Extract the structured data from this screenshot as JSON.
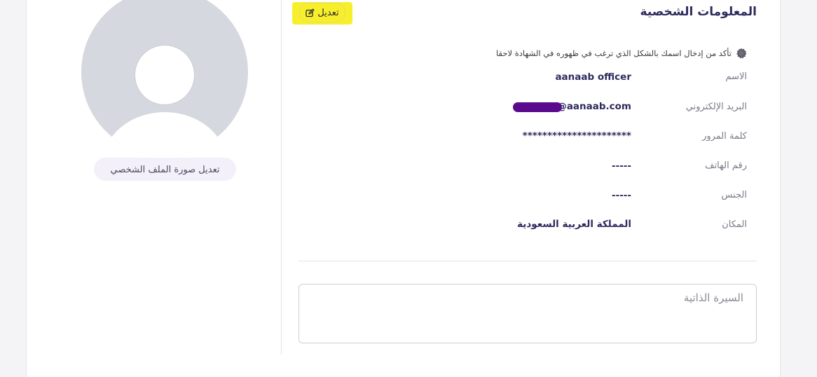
{
  "profile": {
    "section_title": "المعلومات الشخصية",
    "edit_label": "تعديل",
    "edit_photo_label": "تعديل صورة الملف الشخصي",
    "note": "تأكد من إدخال اسمك بالشكل الذي ترغب في ظهوره في الشهادة لاحقا",
    "fields": [
      {
        "label": "الاسم",
        "value": "aanaab officer"
      },
      {
        "label": "البريد الإلكتروني",
        "value": "@aanaab.com"
      },
      {
        "label": "كلمة المرور",
        "value": "**********************"
      },
      {
        "label": "رقم الهاتف",
        "value": "-----"
      },
      {
        "label": "الجنس",
        "value": "-----"
      },
      {
        "label": "المكان",
        "value": "المملكة العربية السعودية"
      }
    ],
    "bio_placeholder": "السيرة الذاتية",
    "bio_value": ""
  },
  "colors": {
    "accent": "#2e2a5e",
    "highlight": "#f7ef2c",
    "redaction": "#5b0a8e",
    "avatar_bg": "#d5d8df",
    "page_bg": "#f4f4f6"
  },
  "icons": {
    "edit": "pencil-square-icon",
    "note": "gear-badge-icon",
    "avatar": "user-silhouette-icon"
  }
}
